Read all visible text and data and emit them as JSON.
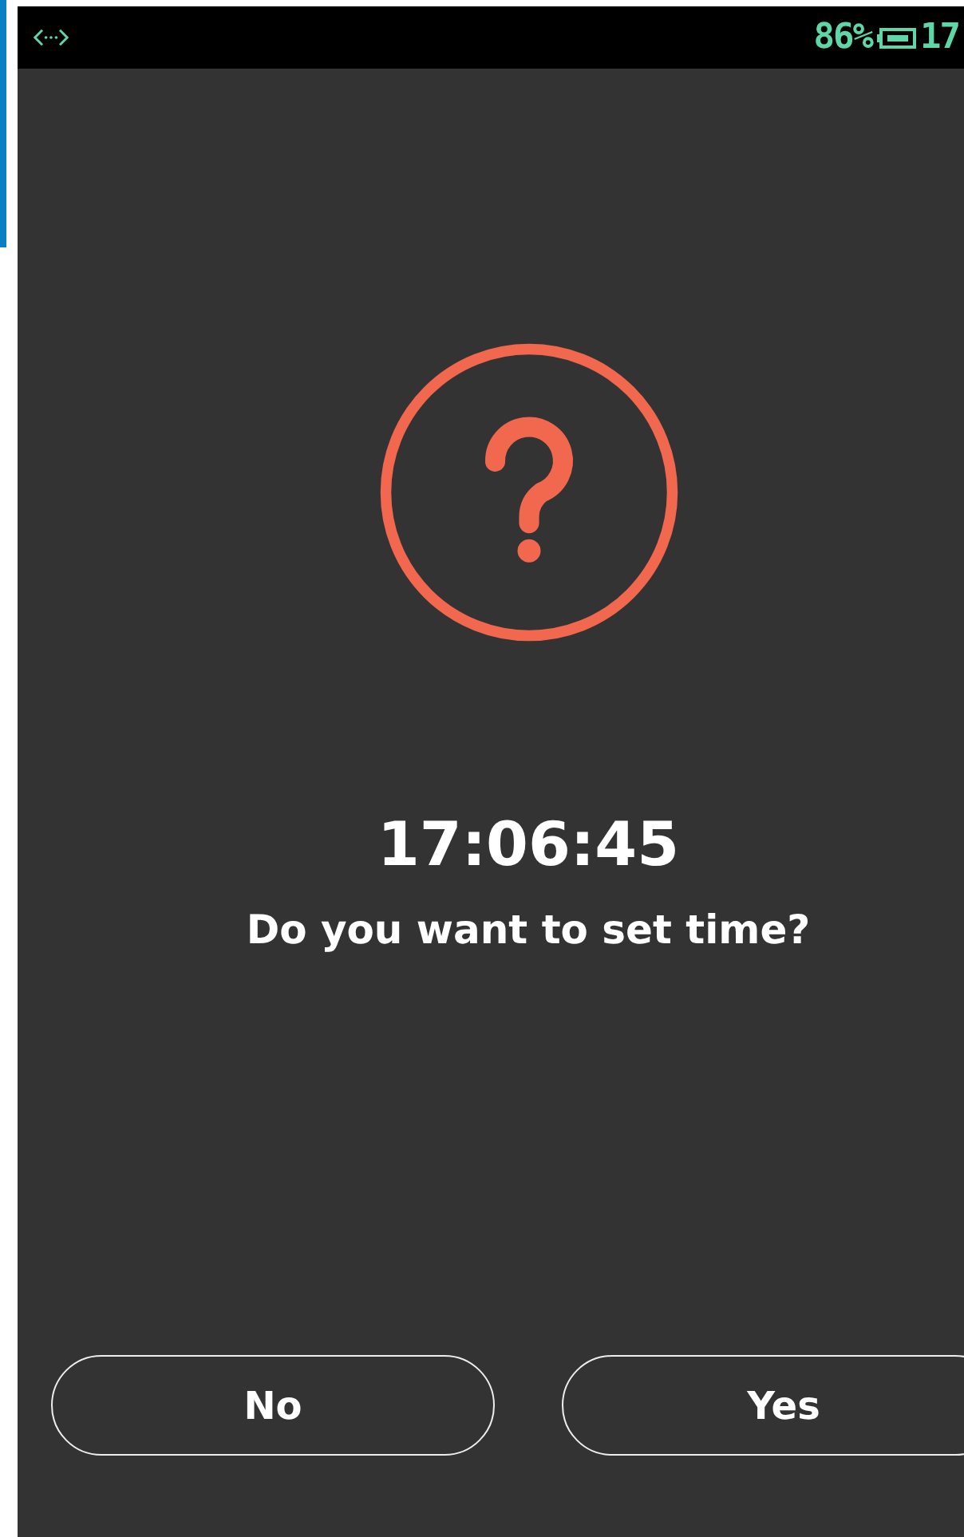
{
  "status_bar": {
    "battery_percent": "86%",
    "clock": "17"
  },
  "dialog": {
    "time": "17:06:45",
    "question": "Do you want to set time?"
  },
  "buttons": [
    {
      "label": "No"
    },
    {
      "label": "Yes"
    }
  ]
}
